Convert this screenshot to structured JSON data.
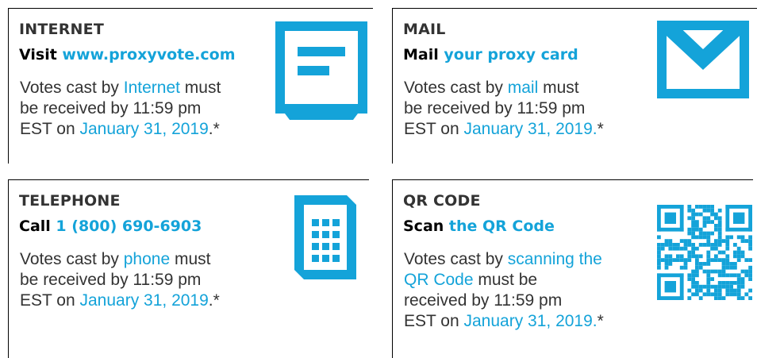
{
  "colors": {
    "accent": "#14a3d9",
    "text": "#333333",
    "rule": "#000000"
  },
  "cards": {
    "internet": {
      "title": "INTERNET",
      "sub_prefix": "Visit",
      "sub_accent": "www.proxyvote.com",
      "lines": [
        [
          "Votes cast by ",
          "Internet",
          " must"
        ],
        [
          "be received by 11:59 pm"
        ],
        [
          "EST on ",
          "January 31, 2019",
          ".*"
        ]
      ],
      "icon": "computer-monitor-icon"
    },
    "mail": {
      "title": "MAIL",
      "sub_prefix": "Mail",
      "sub_accent": "your proxy card",
      "lines": [
        [
          "Votes cast by ",
          "mail",
          " must"
        ],
        [
          "be received by 11:59 pm"
        ],
        [
          "EST on ",
          "January 31, 2019.",
          "*"
        ]
      ],
      "icon": "envelope-icon"
    },
    "telephone": {
      "title": "TELEPHONE",
      "sub_prefix": "Call",
      "sub_accent": "1 (800) 690-6903",
      "lines": [
        [
          "Votes cast by ",
          "phone",
          " must"
        ],
        [
          "be received by 11:59 pm"
        ],
        [
          "EST on ",
          "January 31, 2019",
          ".*"
        ]
      ],
      "icon": "phone-keypad-icon"
    },
    "qr": {
      "title": "QR CODE",
      "sub_prefix": "Scan",
      "sub_accent": "the QR Code",
      "lines": [
        [
          "Votes cast by ",
          "scanning the",
          ""
        ],
        [
          "",
          "QR Code",
          " must be"
        ],
        [
          "received by 11:59 pm"
        ],
        [
          "EST on ",
          "January 31, 2019.",
          "*"
        ]
      ],
      "icon": "qr-code-icon"
    }
  }
}
